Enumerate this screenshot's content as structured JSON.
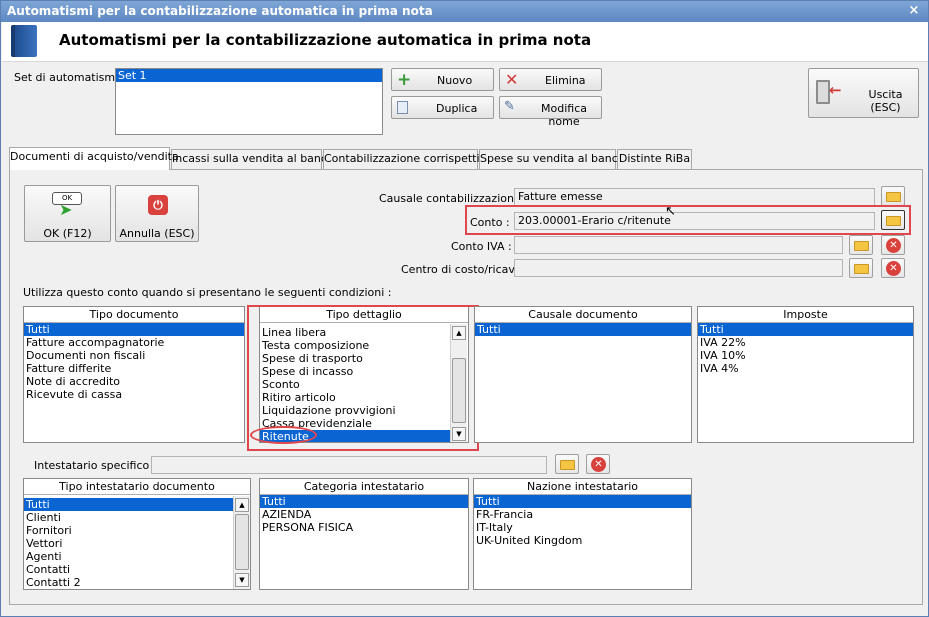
{
  "window": {
    "title": "Automatismi per la contabilizzazione automatica in prima nota",
    "header_title": "Automatismi per la contabilizzazione automatica in prima nota",
    "close_glyph": "×"
  },
  "set": {
    "label": "Set di automatismi :",
    "items": [
      "Set 1"
    ]
  },
  "toolbar": {
    "new_label": "Nuovo",
    "delete_label": "Elimina",
    "duplicate_label": "Duplica",
    "rename_label": "Modifica nome",
    "exit_label": "Uscita (ESC)"
  },
  "tabs": [
    "Documenti di acquisto/vendita",
    "Incassi sulla vendita al banco",
    "Contabilizzazione corrispettivi",
    "Spese su vendita al banco",
    "Distinte RiBa"
  ],
  "actions": {
    "ok_label": "OK (F12)",
    "ok_badge": "OK",
    "cancel_label": "Annulla (ESC)"
  },
  "fields": {
    "causale_label": "Causale contabilizzazione :",
    "causale_value": "Fatture emesse",
    "conto_label": "Conto :",
    "conto_value": "203.00001-Erario c/ritenute",
    "conto_iva_label": "Conto IVA :",
    "conto_iva_value": "",
    "centro_label": "Centro di costo/ricavo",
    "centro_value": "",
    "conditions_label": "Utilizza questo conto quando si presentano le seguenti condizioni :",
    "intestatario_label": "Intestatario specifico :",
    "intestatario_value": ""
  },
  "lists": {
    "tipo_documento": {
      "header": "Tipo documento",
      "items": [
        "Tutti",
        "Fatture accompagnatorie",
        "Documenti non fiscali",
        "Fatture differite",
        "Note di accredito",
        "Ricevute di cassa"
      ],
      "selected": 0
    },
    "tipo_dettaglio": {
      "header": "Tipo dettaglio",
      "items": [
        "Linea libera",
        "Testa composizione",
        "Spese di trasporto",
        "Spese di incasso",
        "Sconto",
        "Ritiro articolo",
        "Liquidazione provvigioni",
        "Cassa previdenziale",
        "Ritenute"
      ],
      "selected": 8
    },
    "causale_documento": {
      "header": "Causale documento",
      "items": [
        "Tutti"
      ],
      "selected": 0
    },
    "imposte": {
      "header": "Imposte",
      "items": [
        "Tutti",
        "IVA 22%",
        "IVA 10%",
        "IVA 4%"
      ],
      "selected": 0
    },
    "tipo_intestatario": {
      "header": "Tipo intestatario documento",
      "items": [
        "Tutti",
        "Clienti",
        "Fornitori",
        "Vettori",
        "Agenti",
        "Contatti",
        "Contatti 2"
      ],
      "selected": 0
    },
    "categoria_intestatario": {
      "header": "Categoria intestatario",
      "items": [
        "Tutti",
        "AZIENDA",
        "PERSONA FISICA"
      ],
      "selected": 0
    },
    "nazione_intestatario": {
      "header": "Nazione intestatario",
      "items": [
        "Tutti",
        "FR-Francia",
        "IT-Italy",
        "UK-United Kingdom"
      ],
      "selected": 0
    }
  },
  "colors": {
    "selection": "#0a64d2",
    "highlight_box": "#e0474c",
    "titlebar": "#6d95cc"
  }
}
